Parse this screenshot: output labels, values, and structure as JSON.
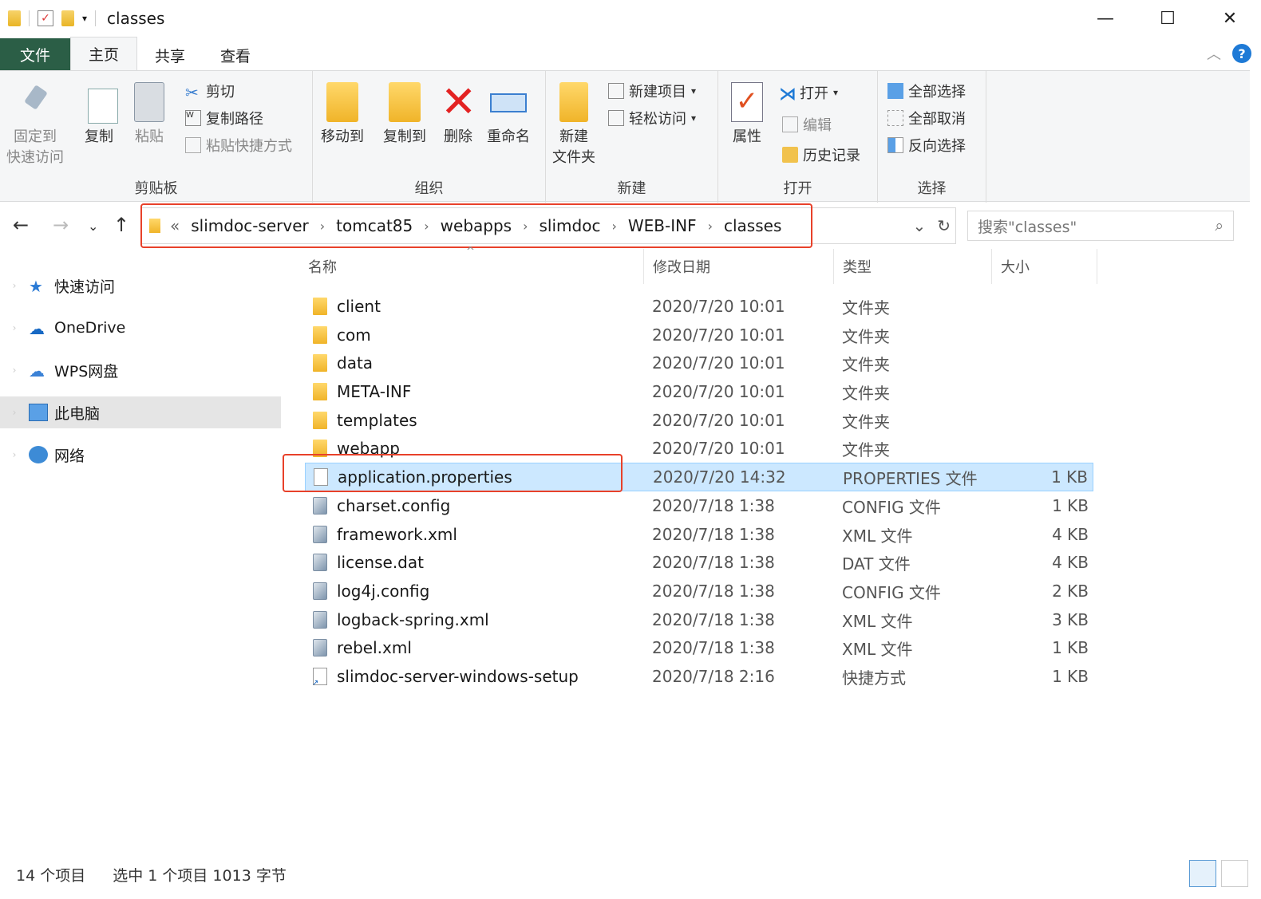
{
  "window": {
    "title": "classes",
    "controls": [
      "—",
      "☐",
      "✕"
    ]
  },
  "ribbon_tabs": [
    {
      "label": "文件"
    },
    {
      "label": "主页"
    },
    {
      "label": "共享"
    },
    {
      "label": "查看"
    }
  ],
  "ribbon": {
    "clipboard": {
      "label": "剪贴板",
      "pin_label_1": "固定到",
      "pin_label_2": "快速访问",
      "copy": "复制",
      "paste": "粘贴",
      "cut": "剪切",
      "copy_path": "复制路径",
      "paste_shortcut": "粘贴快捷方式"
    },
    "organize": {
      "label": "组织",
      "move_to": "移动到",
      "copy_to": "复制到",
      "delete": "删除",
      "rename": "重命名"
    },
    "new": {
      "label": "新建",
      "new_folder_1": "新建",
      "new_folder_2": "文件夹",
      "new_item": "新建项目",
      "easy_access": "轻松访问"
    },
    "open": {
      "label": "打开",
      "properties": "属性",
      "open": "打开",
      "edit": "编辑",
      "history": "历史记录"
    },
    "select": {
      "label": "选择",
      "select_all": "全部选择",
      "select_none": "全部取消",
      "invert": "反向选择"
    }
  },
  "nav": {
    "breadcrumb": [
      "slimdoc-server",
      "tomcat85",
      "webapps",
      "slimdoc",
      "WEB-INF",
      "classes"
    ],
    "overflow": "«",
    "search_placeholder": "搜索\"classes\""
  },
  "sidebar": [
    {
      "label": "快速访问",
      "icon": "star-icon"
    },
    {
      "label": "OneDrive",
      "icon": "cloud-icon"
    },
    {
      "label": "WPS网盘",
      "icon": "cloud-outline-icon"
    },
    {
      "label": "此电脑",
      "icon": "computer-icon",
      "selected": true
    },
    {
      "label": "网络",
      "icon": "network-icon"
    }
  ],
  "columns": {
    "name": "名称",
    "date": "修改日期",
    "type": "类型",
    "size": "大小"
  },
  "files": [
    {
      "name": "client",
      "date": "2020/7/20 10:01",
      "type": "文件夹",
      "size": "",
      "icon": "folder"
    },
    {
      "name": "com",
      "date": "2020/7/20 10:01",
      "type": "文件夹",
      "size": "",
      "icon": "folder"
    },
    {
      "name": "data",
      "date": "2020/7/20 10:01",
      "type": "文件夹",
      "size": "",
      "icon": "folder"
    },
    {
      "name": "META-INF",
      "date": "2020/7/20 10:01",
      "type": "文件夹",
      "size": "",
      "icon": "folder"
    },
    {
      "name": "templates",
      "date": "2020/7/20 10:01",
      "type": "文件夹",
      "size": "",
      "icon": "folder"
    },
    {
      "name": "webapp",
      "date": "2020/7/20 10:01",
      "type": "文件夹",
      "size": "",
      "icon": "folder"
    },
    {
      "name": "application.properties",
      "date": "2020/7/20 14:32",
      "type": "PROPERTIES 文件",
      "size": "1 KB",
      "icon": "file",
      "selected": true
    },
    {
      "name": "charset.config",
      "date": "2020/7/18 1:38",
      "type": "CONFIG 文件",
      "size": "1 KB",
      "icon": "cfg"
    },
    {
      "name": "framework.xml",
      "date": "2020/7/18 1:38",
      "type": "XML 文件",
      "size": "4 KB",
      "icon": "cfg"
    },
    {
      "name": "license.dat",
      "date": "2020/7/18 1:38",
      "type": "DAT 文件",
      "size": "4 KB",
      "icon": "cfg"
    },
    {
      "name": "log4j.config",
      "date": "2020/7/18 1:38",
      "type": "CONFIG 文件",
      "size": "2 KB",
      "icon": "cfg"
    },
    {
      "name": "logback-spring.xml",
      "date": "2020/7/18 1:38",
      "type": "XML 文件",
      "size": "3 KB",
      "icon": "cfg"
    },
    {
      "name": "rebel.xml",
      "date": "2020/7/18 1:38",
      "type": "XML 文件",
      "size": "1 KB",
      "icon": "cfg"
    },
    {
      "name": "slimdoc-server-windows-setup",
      "date": "2020/7/18 2:16",
      "type": "快捷方式",
      "size": "1 KB",
      "icon": "lnk"
    }
  ],
  "status": {
    "count": "14 个项目",
    "selected": "选中 1 个项目  1013 字节"
  }
}
